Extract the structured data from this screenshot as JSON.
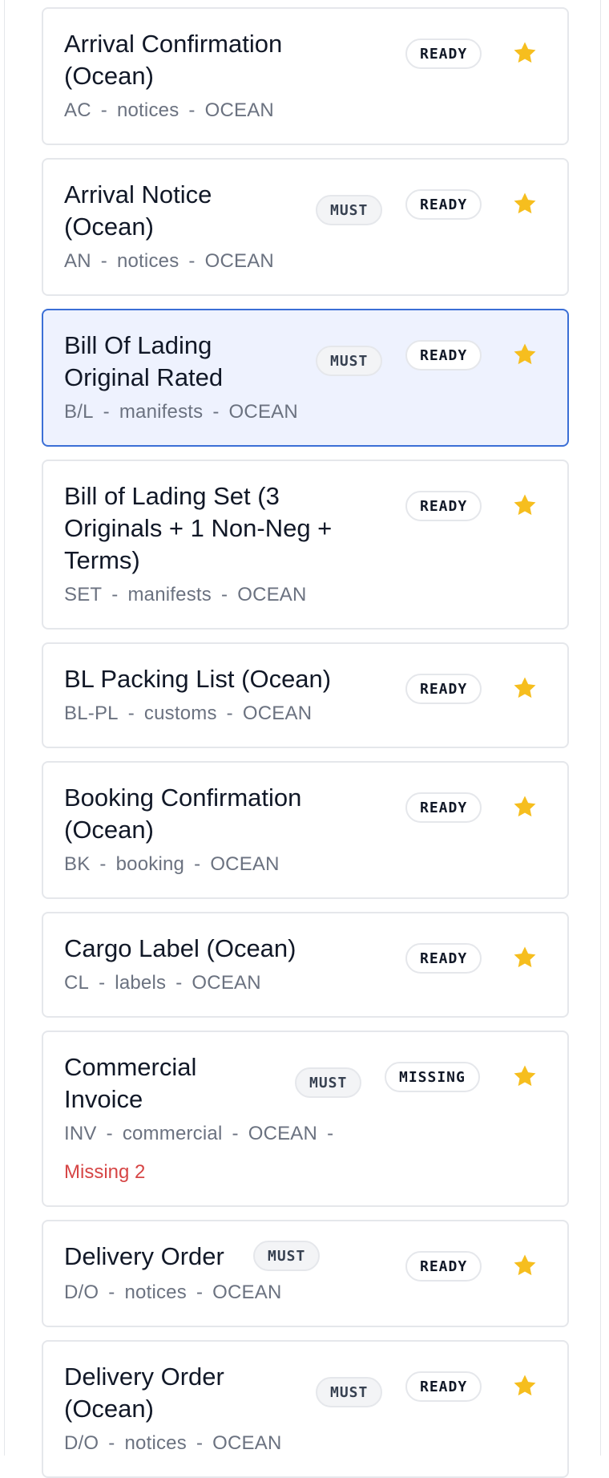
{
  "colors": {
    "star": "#F6BE1E",
    "missing_text": "#D64545",
    "selected_border": "#3B6FD6",
    "selected_bg": "#EEF2FE"
  },
  "documents": [
    {
      "title_line1": "Arrival Confirmation",
      "title_line2": "(Ocean)",
      "code": "AC",
      "category": "notices",
      "mode": "OCEAN",
      "must": "",
      "status": "READY",
      "favorite": true
    },
    {
      "title_line1": "Arrival Notice",
      "title_line2": "(Ocean)",
      "code": "AN",
      "category": "notices",
      "mode": "OCEAN",
      "must": "MUST",
      "status": "READY",
      "favorite": true
    },
    {
      "title_line1": "Bill Of Lading",
      "title_line2": "Original Rated",
      "code": "B/L",
      "category": "manifests",
      "mode": "OCEAN",
      "must": "MUST",
      "status": "READY",
      "favorite": true,
      "selected": true
    },
    {
      "title_line1": "Bill of Lading Set (3",
      "title_line2": "Originals + 1 Non-Neg +",
      "title_line3": "Terms)",
      "code": "SET",
      "category": "manifests",
      "mode": "OCEAN",
      "must": "",
      "status": "READY",
      "favorite": true
    },
    {
      "title_line1": "BL Packing List (Ocean)",
      "code": "BL-PL",
      "category": "customs",
      "mode": "OCEAN",
      "must": "",
      "status": "READY",
      "favorite": true
    },
    {
      "title_line1": "Booking Confirmation",
      "title_line2": "(Ocean)",
      "code": "BK",
      "category": "booking",
      "mode": "OCEAN",
      "must": "",
      "status": "READY",
      "favorite": true
    },
    {
      "title_line1": "Cargo Label (Ocean)",
      "code": "CL",
      "category": "labels",
      "mode": "OCEAN",
      "must": "",
      "status": "READY",
      "favorite": true
    },
    {
      "title_line1": "Commercial",
      "title_line2": "Invoice",
      "code": "INV",
      "category": "commercial",
      "mode": "OCEAN",
      "must": "MUST",
      "status": "MISSING",
      "missing_note": "Missing 2",
      "favorite": true
    },
    {
      "title_line1": "Delivery Order",
      "code": "D/O",
      "category": "notices",
      "mode": "OCEAN",
      "must": "MUST",
      "status": "READY",
      "favorite": true
    },
    {
      "title_line1": "Delivery Order",
      "title_line2": "(Ocean)",
      "code": "D/O",
      "category": "notices",
      "mode": "OCEAN",
      "must": "MUST",
      "status": "READY",
      "favorite": true
    }
  ]
}
